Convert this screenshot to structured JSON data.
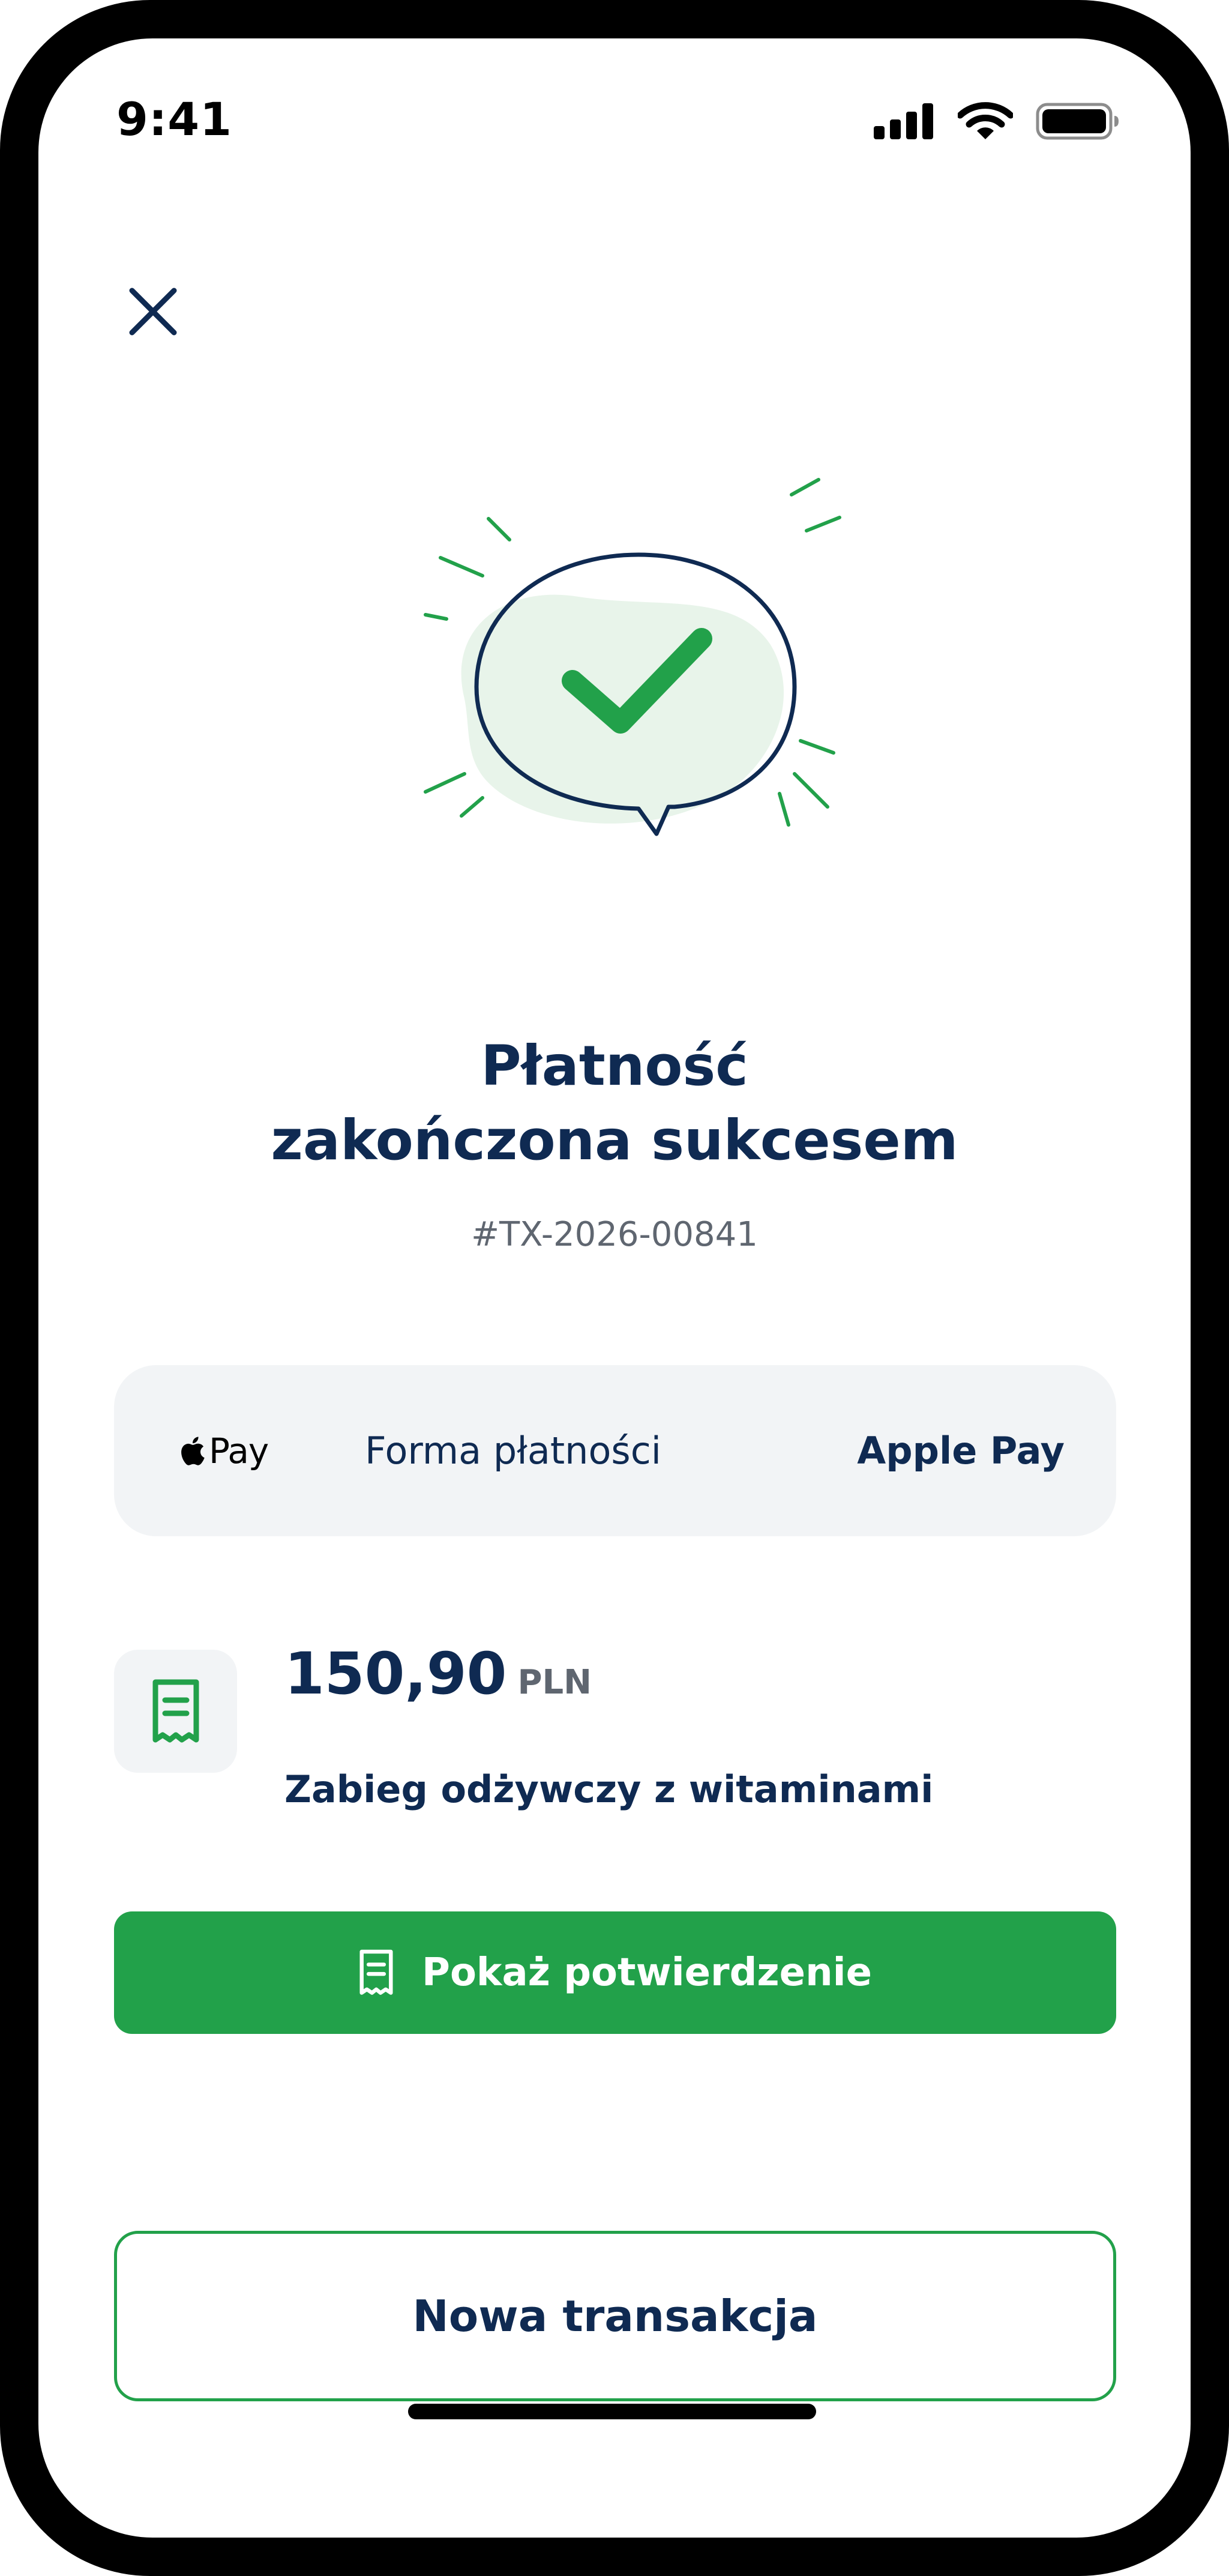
{
  "status_bar": {
    "time": "9:41",
    "icons": [
      "signal-icon",
      "wifi-icon",
      "battery-icon"
    ]
  },
  "header": {
    "close_icon": "close-icon"
  },
  "illustration": {
    "icon": "success-checkmark-speech-bubble-icon"
  },
  "result": {
    "title_line1": "Płatność",
    "title_line2": "zakończona sukcesem",
    "transaction_id": "#TX-2026-00841"
  },
  "payment_method": {
    "logo_text": "Pay",
    "logo_icon": "apple-logo-icon",
    "label": "Forma płatności",
    "value": "Apple Pay"
  },
  "amount": {
    "value": "150,90",
    "currency": "PLN",
    "description": "Zabieg odżywczy z witaminami",
    "icon": "receipt-icon"
  },
  "actions": {
    "show_confirmation_label": "Pokaż potwierdzenie",
    "new_transaction_label": "Nowa transakcja"
  },
  "colors": {
    "primary_green": "#22a14a",
    "navy": "#0f2a52",
    "muted_grey": "#5f6670",
    "card_bg": "#f2f4f6"
  }
}
